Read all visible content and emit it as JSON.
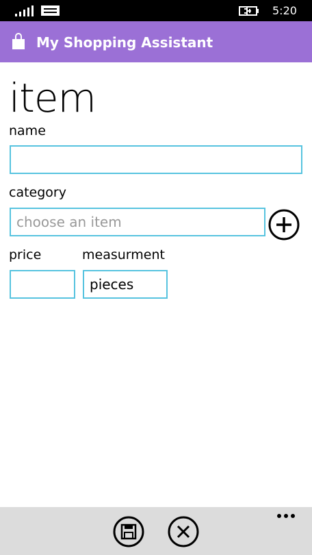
{
  "status_bar": {
    "time": "5:20",
    "icons": [
      "signal-strength-icon",
      "message-icon",
      "battery-charging-icon"
    ]
  },
  "app_bar": {
    "title": "My Shopping Assistant",
    "icon": "shopping-bag-icon",
    "background": "#9b70d6"
  },
  "page": {
    "heading": "item"
  },
  "form": {
    "name": {
      "label": "name",
      "value": ""
    },
    "category": {
      "label": "category",
      "placeholder": "choose an item",
      "add_icon": "add-circle-icon"
    },
    "price": {
      "label": "price",
      "value": ""
    },
    "measurement": {
      "label": "measurment",
      "value": "pieces"
    },
    "border_color": "#56c3df"
  },
  "bottom_bar": {
    "buttons": [
      {
        "icon": "save-icon"
      },
      {
        "icon": "cancel-icon"
      }
    ],
    "more_icon": "more-ellipsis-icon"
  }
}
